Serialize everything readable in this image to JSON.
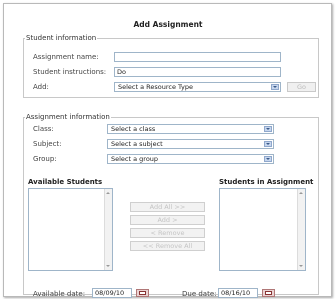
{
  "title": "Add Assignment",
  "student_information": {
    "legend": "Student information",
    "assignment_name_label": "Assignment name:",
    "assignment_name_value": "",
    "student_instructions_label": "Student instructions:",
    "student_instructions_value": "Do",
    "add_label": "Add:",
    "resource_type_value": "Select a Resource Type",
    "go_button": "Go"
  },
  "assignment_information": {
    "legend": "Assignment information",
    "class_label": "Class:",
    "class_value": "Select a class",
    "subject_label": "Subject:",
    "subject_value": "Select a subject",
    "group_label": "Group:",
    "group_value": "Select a group",
    "available_students_heading": "Available Students",
    "students_in_assignment_heading": "Students in Assignment",
    "add_all_button": "Add All >>",
    "add_button": "Add >",
    "remove_button": "< Remove",
    "remove_all_button": "<< Remove All",
    "available_date_label": "Available date:",
    "available_date_value": "08/09/10",
    "due_date_label": "Due date:",
    "due_date_value": "08/16/10"
  },
  "icons": {
    "dropdown": "chevron-down-icon",
    "calendar": "calendar-icon"
  },
  "colors": {
    "field_border": "#9fb5c9",
    "dropdown_button": "#c6d6ee",
    "disabled_text": "#c4c4c4",
    "calendar_icon": "#ead3d3"
  }
}
